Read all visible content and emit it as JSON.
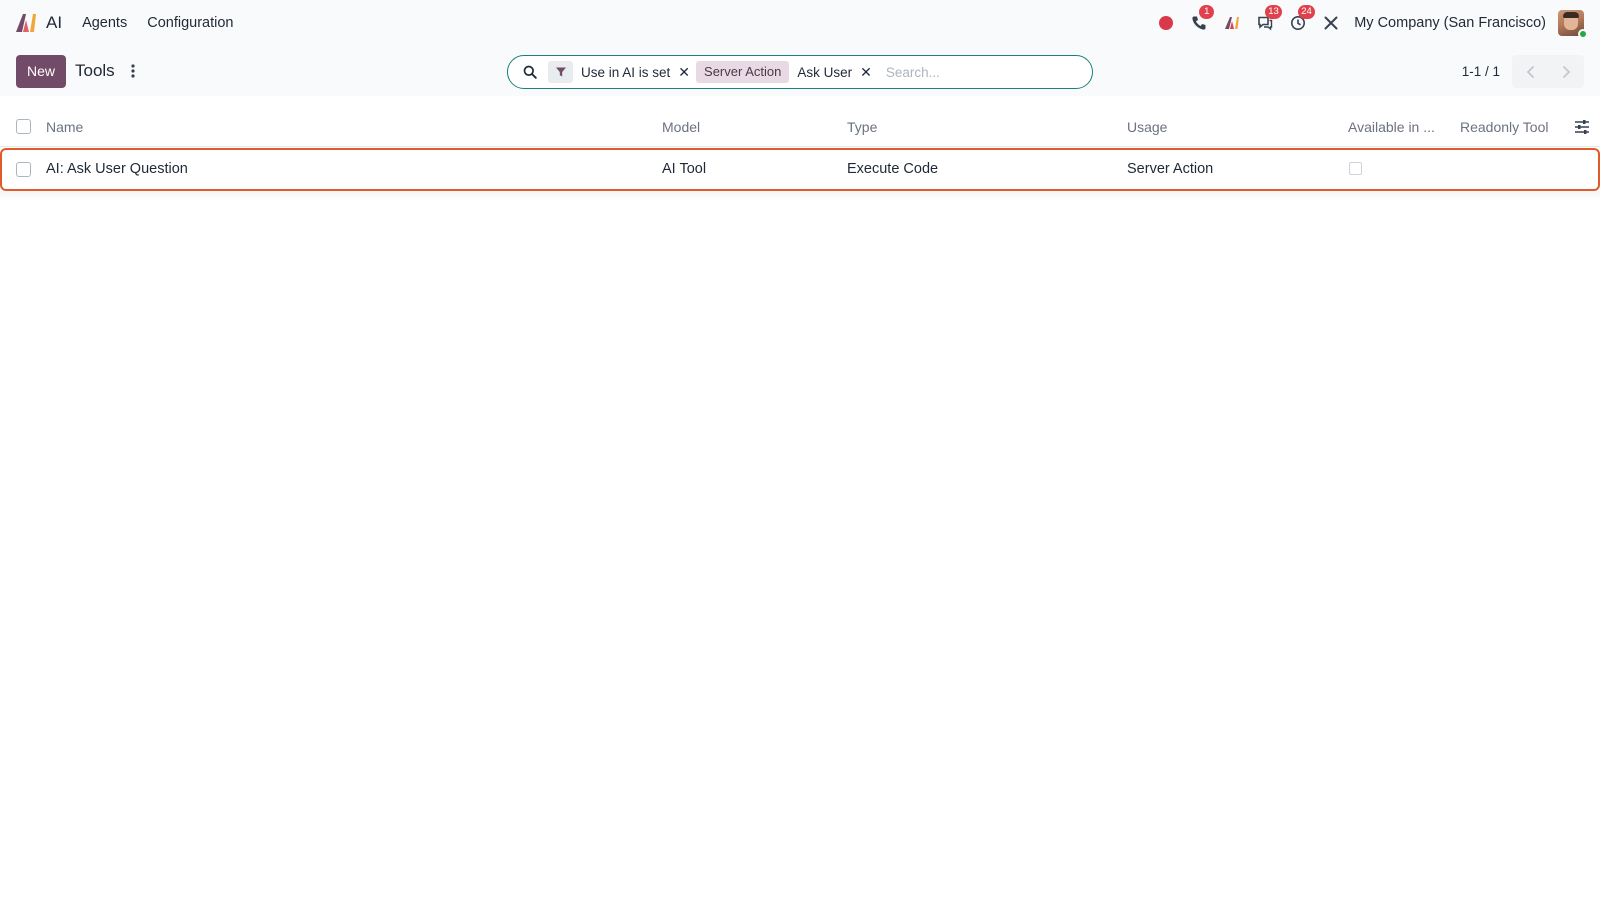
{
  "colors": {
    "brand": "#714b67",
    "accent_border": "#e05a2b",
    "badge": "#e0424d",
    "search_border": "#1a7f7f"
  },
  "navbar": {
    "app_name": "AI",
    "menus": [
      "Agents",
      "Configuration"
    ],
    "icons": [
      "record-icon",
      "phone-icon",
      "ai-icon",
      "chat-icon",
      "activity-clock-icon",
      "tools-icon"
    ],
    "phone_badge": "1",
    "chat_badge": "13",
    "activity_badge": "24",
    "company": "My Company (San Francisco)"
  },
  "control": {
    "new_label": "New",
    "title": "Tools",
    "search": {
      "filter_facet": "Use in AI is set",
      "group_label": "Server Action",
      "group_value": "Ask User",
      "placeholder": "Search..."
    },
    "pager": "1-1 / 1"
  },
  "table": {
    "columns": [
      "Name",
      "Model",
      "Type",
      "Usage",
      "Available in ...",
      "Readonly Tool"
    ],
    "rows": [
      {
        "name": "AI: Ask User Question",
        "model": "AI Tool",
        "type": "Execute Code",
        "usage": "Server Action"
      }
    ]
  }
}
